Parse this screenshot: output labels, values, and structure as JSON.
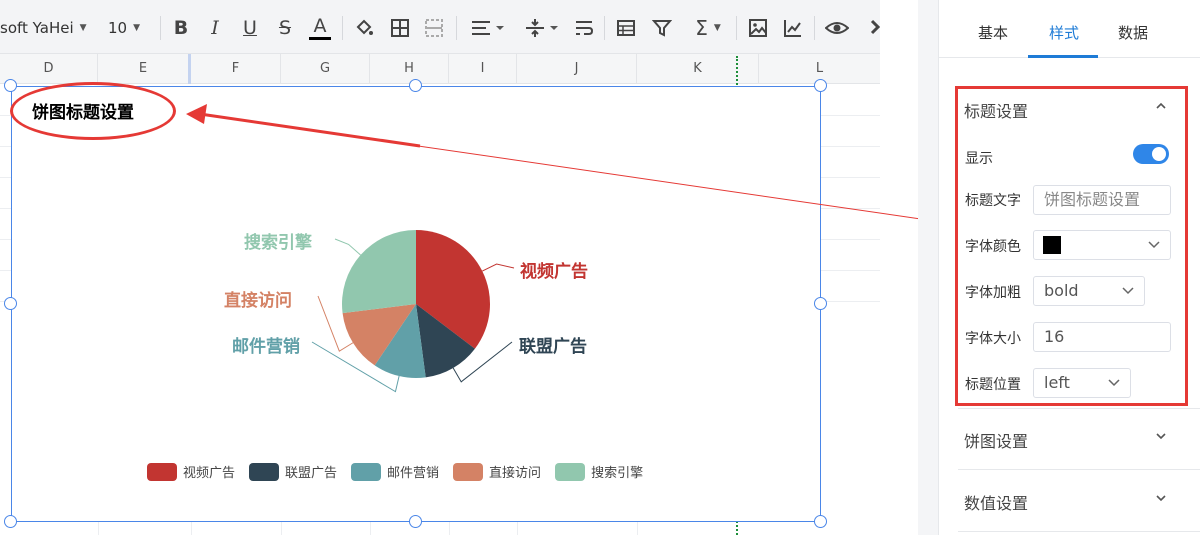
{
  "toolbar": {
    "font_name": "soft YaHei",
    "font_size": "10",
    "bold": "B",
    "italic": "I",
    "underline": "U",
    "strike": "S",
    "font_color": "A",
    "sum": "Σ"
  },
  "columns": [
    "D",
    "E",
    "F",
    "G",
    "H",
    "I",
    "J",
    "K",
    "L"
  ],
  "chart": {
    "title": "饼图标题设置",
    "colors": {
      "video": "#c23531",
      "union": "#2f4554",
      "email": "#61a0a8",
      "direct": "#d48265",
      "search": "#91c7ae"
    }
  },
  "chart_data": {
    "type": "pie",
    "title": "饼图标题设置",
    "legend_position": "bottom",
    "categories": [
      "视频广告",
      "联盟广告",
      "邮件营销",
      "直接访问",
      "搜索引擎"
    ],
    "values": [
      135,
      48,
      44,
      52,
      103
    ]
  },
  "panel": {
    "tabs": [
      "基本",
      "样式",
      "数据"
    ],
    "active_tab": "样式",
    "section_title": "标题设置",
    "show_label": "显示",
    "show_value": true,
    "title_text_label": "标题文字",
    "title_text_value": "饼图标题设置",
    "font_color_label": "字体颜色",
    "font_color_value": "#000000",
    "font_weight_label": "字体加粗",
    "font_weight_value": "bold",
    "font_size_label": "字体大小",
    "font_size_value": "16",
    "title_pos_label": "标题位置",
    "title_pos_value": "left",
    "pie_settings": "饼图设置",
    "value_settings": "数值设置"
  }
}
